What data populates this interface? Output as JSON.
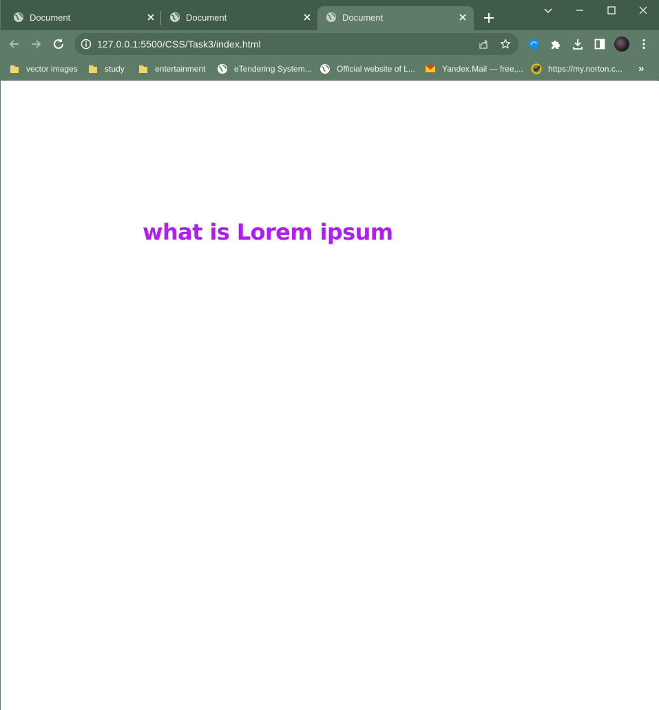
{
  "tabs": [
    {
      "title": "Document"
    },
    {
      "title": "Document"
    },
    {
      "title": "Document"
    }
  ],
  "toolbar": {
    "url": "127.0.0.1:5500/CSS/Task3/index.html"
  },
  "bookmarks": [
    {
      "label": "vector images",
      "icon": "folder-icon"
    },
    {
      "label": "study",
      "icon": "folder-icon"
    },
    {
      "label": "entertainment",
      "icon": "folder-icon"
    },
    {
      "label": "eTendering System...",
      "icon": "globe-icon"
    },
    {
      "label": "Official website of L...",
      "icon": "globe-icon"
    },
    {
      "label": "Yandex.Mail — free,...",
      "icon": "mail-icon"
    },
    {
      "label": "https://my.norton.c...",
      "icon": "norton-icon"
    }
  ],
  "bookmarks_more": "»",
  "page": {
    "heading": "what is Lorem ipsum"
  },
  "colors": {
    "tab_strip": "#3f5c49",
    "toolbar": "#5e7b67",
    "heading": "#b01ef0"
  }
}
